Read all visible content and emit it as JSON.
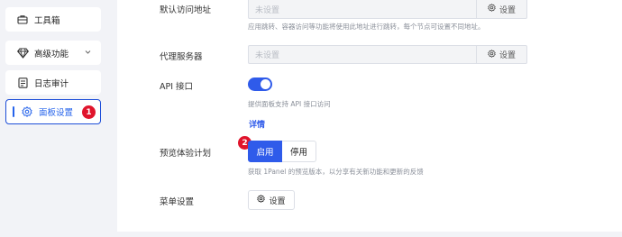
{
  "sidebar": {
    "items": [
      {
        "label": "工具箱",
        "icon": "toolbox-icon"
      },
      {
        "label": "高级功能",
        "icon": "diamond-icon",
        "has_chevron": true
      },
      {
        "label": "日志审计",
        "icon": "log-icon"
      },
      {
        "label": "面板设置",
        "icon": "gear-icon",
        "active": true,
        "badge": "1"
      }
    ]
  },
  "settings": {
    "default_url": {
      "label": "默认访问地址",
      "placeholder": "未设置",
      "button": "设置",
      "hint": "应用跳转、容器访问等功能将使用此地址进行跳转，每个节点可设置不同地址。"
    },
    "proxy": {
      "label": "代理服务器",
      "placeholder": "未设置",
      "button": "设置"
    },
    "api": {
      "label": "API 接口",
      "enabled": true,
      "hint": "提供面板支持 API 接口访问",
      "link": "详情"
    },
    "preview": {
      "label": "预览体验计划",
      "on_label": "启用",
      "off_label": "停用",
      "selected": "启用",
      "badge": "2",
      "hint": "获取 1Panel 的预览版本，以分享有关新功能和更新的反馈"
    },
    "menu": {
      "label": "菜单设置",
      "button": "设置"
    }
  },
  "colors": {
    "accent": "#2f5bea",
    "badge": "#e0142c",
    "background": "#f2f3f7"
  }
}
